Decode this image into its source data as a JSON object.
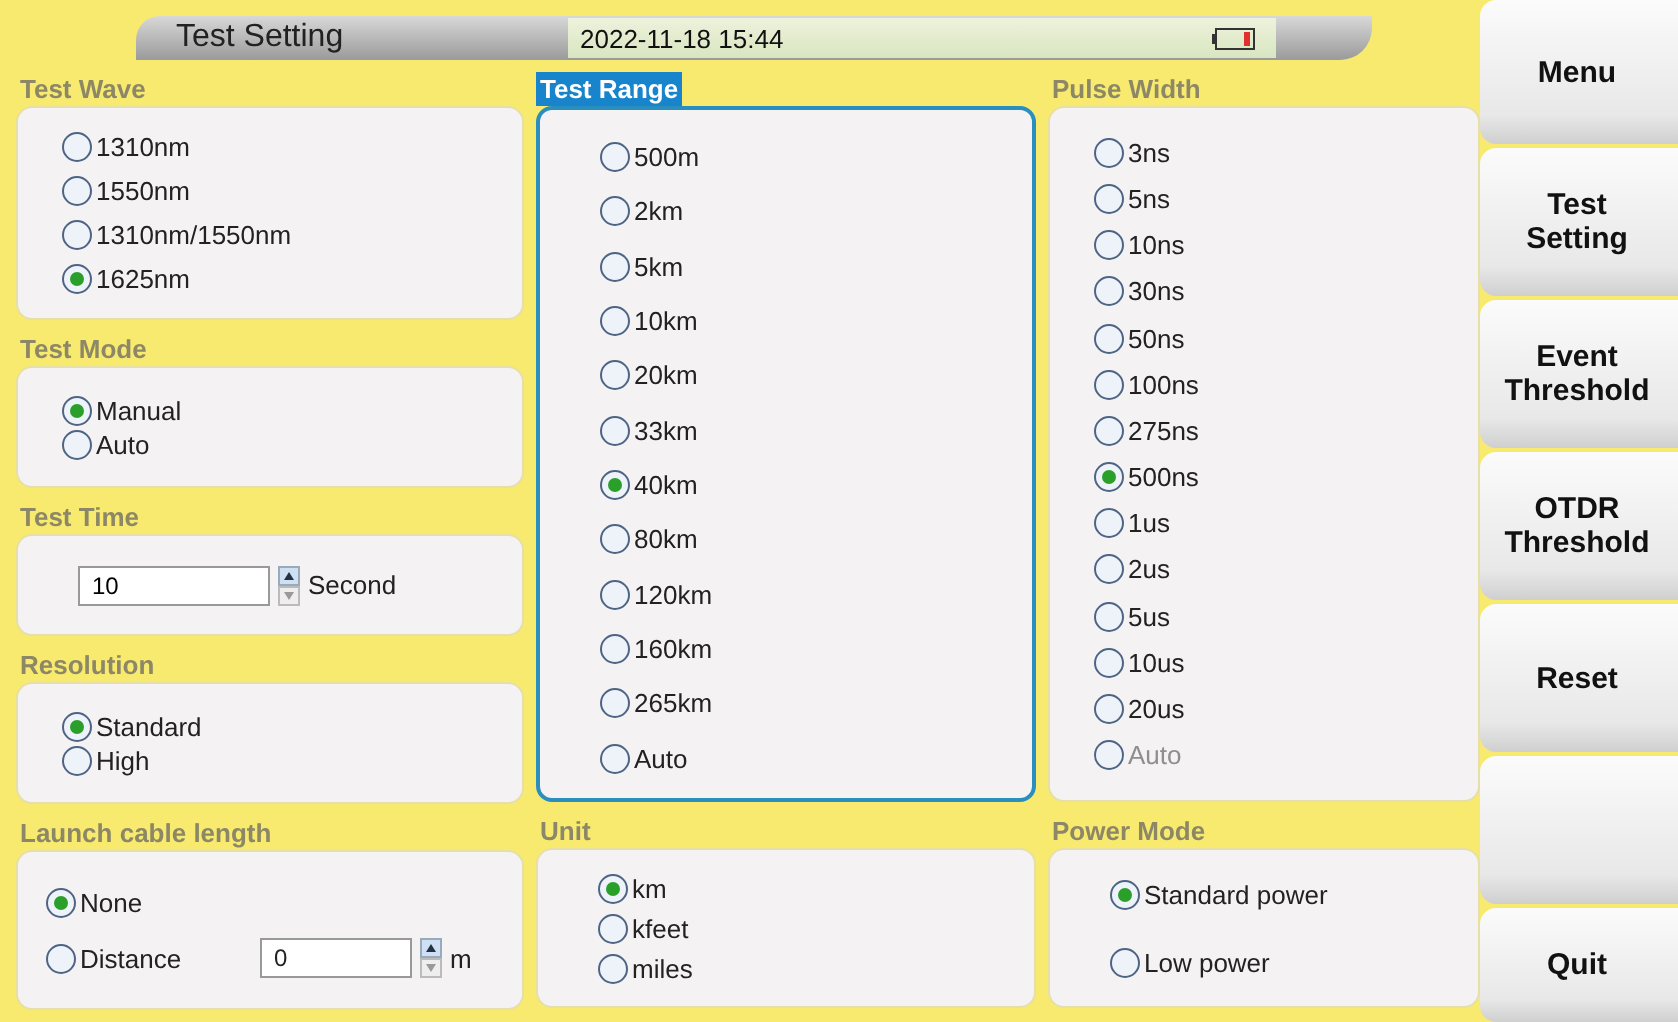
{
  "header": {
    "title": "Test Setting",
    "datetime": "2022-11-18 15:44"
  },
  "columns": [
    [
      {
        "title": "Test Wave",
        "selected": false,
        "options": [
          {
            "label": "1310nm",
            "selected": false,
            "disabled": false
          },
          {
            "label": "1550nm",
            "selected": false,
            "disabled": false
          },
          {
            "label": "1310nm/1550nm",
            "selected": false,
            "disabled": false
          },
          {
            "label": "1625nm",
            "selected": true,
            "disabled": false
          }
        ]
      },
      {
        "title": "Test Mode",
        "selected": false,
        "options": [
          {
            "label": "Manual",
            "selected": true,
            "disabled": false
          },
          {
            "label": "Auto",
            "selected": false,
            "disabled": false
          }
        ]
      },
      {
        "title": "Test Time",
        "selected": false,
        "spin": {
          "value": "10",
          "unit": "Second"
        }
      },
      {
        "title": "Resolution",
        "selected": false,
        "options": [
          {
            "label": "Standard",
            "selected": true,
            "disabled": false
          },
          {
            "label": "High",
            "selected": false,
            "disabled": false
          }
        ]
      },
      {
        "title": "Launch cable length",
        "selected": false,
        "options": [
          {
            "label": "None",
            "selected": true,
            "disabled": false
          },
          {
            "label": "Distance",
            "selected": false,
            "disabled": false,
            "spin": {
              "value": "0",
              "unit": "m"
            }
          }
        ]
      }
    ],
    [
      {
        "title": "Test Range",
        "selected": true,
        "options": [
          {
            "label": "500m",
            "selected": false,
            "disabled": false
          },
          {
            "label": "2km",
            "selected": false,
            "disabled": false
          },
          {
            "label": "5km",
            "selected": false,
            "disabled": false
          },
          {
            "label": "10km",
            "selected": false,
            "disabled": false
          },
          {
            "label": "20km",
            "selected": false,
            "disabled": false
          },
          {
            "label": "33km",
            "selected": false,
            "disabled": false
          },
          {
            "label": "40km",
            "selected": true,
            "disabled": false
          },
          {
            "label": "80km",
            "selected": false,
            "disabled": false
          },
          {
            "label": "120km",
            "selected": false,
            "disabled": false
          },
          {
            "label": "160km",
            "selected": false,
            "disabled": false
          },
          {
            "label": "265km",
            "selected": false,
            "disabled": false
          },
          {
            "label": "Auto",
            "selected": false,
            "disabled": false
          }
        ]
      },
      {
        "title": "Unit",
        "selected": false,
        "options": [
          {
            "label": "km",
            "selected": true,
            "disabled": false
          },
          {
            "label": "kfeet",
            "selected": false,
            "disabled": false
          },
          {
            "label": "miles",
            "selected": false,
            "disabled": false
          }
        ]
      }
    ],
    [
      {
        "title": "Pulse Width",
        "selected": false,
        "options": [
          {
            "label": "3ns",
            "selected": false,
            "disabled": false
          },
          {
            "label": "5ns",
            "selected": false,
            "disabled": false
          },
          {
            "label": "10ns",
            "selected": false,
            "disabled": false
          },
          {
            "label": "30ns",
            "selected": false,
            "disabled": false
          },
          {
            "label": "50ns",
            "selected": false,
            "disabled": false
          },
          {
            "label": "100ns",
            "selected": false,
            "disabled": false
          },
          {
            "label": "275ns",
            "selected": false,
            "disabled": false
          },
          {
            "label": "500ns",
            "selected": true,
            "disabled": false
          },
          {
            "label": "1us",
            "selected": false,
            "disabled": false
          },
          {
            "label": "2us",
            "selected": false,
            "disabled": false
          },
          {
            "label": "5us",
            "selected": false,
            "disabled": false
          },
          {
            "label": "10us",
            "selected": false,
            "disabled": false
          },
          {
            "label": "20us",
            "selected": false,
            "disabled": false
          },
          {
            "label": "Auto",
            "selected": false,
            "disabled": true
          }
        ]
      },
      {
        "title": "Power Mode",
        "selected": false,
        "options": [
          {
            "label": "Standard power",
            "selected": true,
            "disabled": false
          },
          {
            "label": "Low power",
            "selected": false,
            "disabled": false
          }
        ]
      }
    ]
  ],
  "side_buttons": [
    {
      "kind": "label",
      "label": "Menu"
    },
    {
      "kind": "label",
      "label": "Test Setting"
    },
    {
      "kind": "label",
      "label": "Event Threshold"
    },
    {
      "kind": "label",
      "label": "OTDR Threshold"
    },
    {
      "kind": "label",
      "label": "Reset"
    },
    {
      "kind": "blank"
    },
    {
      "kind": "label",
      "label": "Quit"
    }
  ]
}
